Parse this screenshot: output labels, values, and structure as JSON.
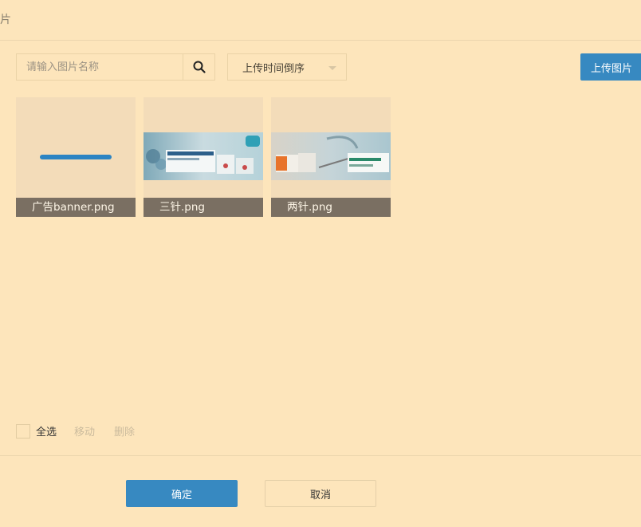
{
  "dialog": {
    "title": "片"
  },
  "toolbar": {
    "search_placeholder": "请输入图片名称",
    "search_icon": "search-icon",
    "sort_value": "上传时间倒序",
    "upload_label": "上传图片"
  },
  "images": [
    {
      "name": "广告banner.png"
    },
    {
      "name": "三针.png"
    },
    {
      "name": "两针.png"
    }
  ],
  "footer": {
    "select_all_label": "全选",
    "move_label": "移动",
    "delete_label": "删除"
  },
  "actions": {
    "confirm_label": "确定",
    "cancel_label": "取消"
  },
  "colors": {
    "background": "#fde5bb",
    "primary": "#3789c1",
    "caption_bg": "#645c52"
  }
}
